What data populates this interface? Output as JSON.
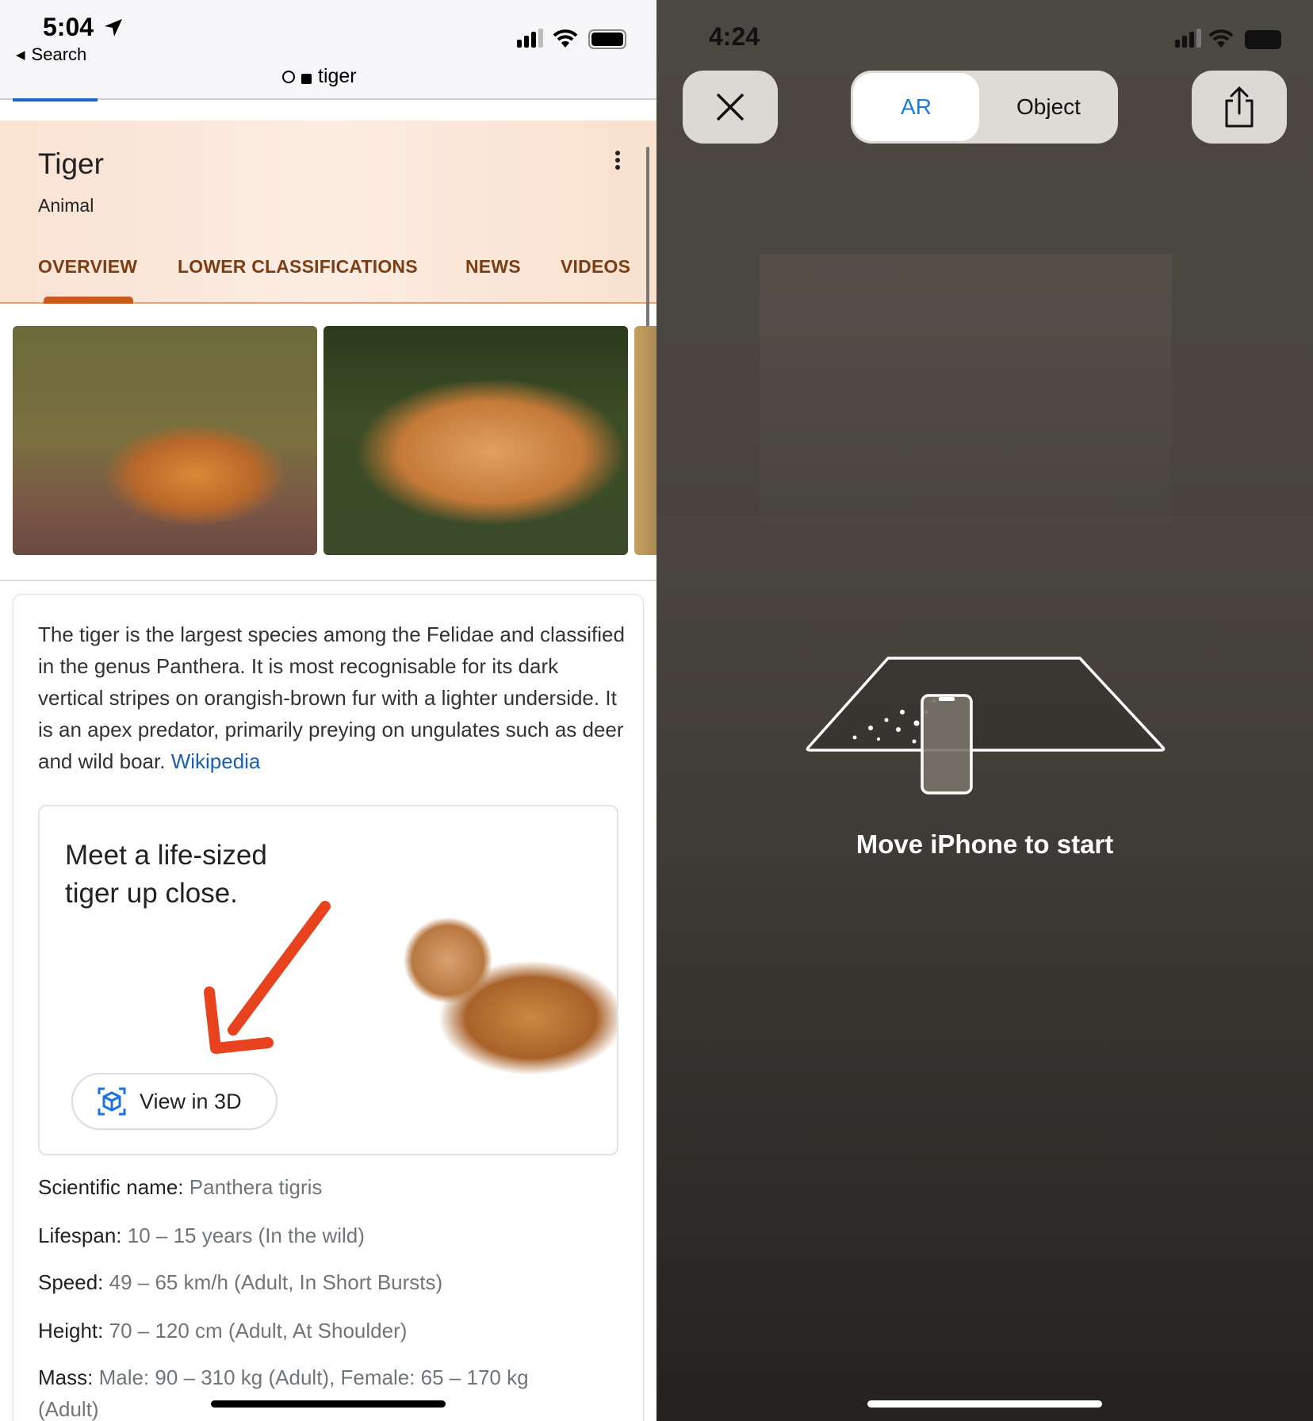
{
  "left": {
    "status": {
      "time": "5:04",
      "back_label": "Search"
    },
    "url_bar": {
      "text": "tiger"
    },
    "panel": {
      "title": "Tiger",
      "subtitle": "Animal",
      "tabs": [
        "OVERVIEW",
        "LOWER CLASSIFICATIONS",
        "NEWS",
        "VIDEOS"
      ],
      "active_tab": "OVERVIEW"
    },
    "description": {
      "text": "The tiger is the largest species among the Felidae and classified in the genus Panthera. It is most recognisable for its dark vertical stripes on orangish-brown fur with a lighter underside. It is an apex predator, primarily preying on ungulates such as deer and wild boar.",
      "source_link": "Wikipedia"
    },
    "promo": {
      "line1": "Meet a life-sized",
      "line2": "tiger up close.",
      "button": "View in 3D"
    },
    "facts": [
      {
        "label": "Scientific name:",
        "value": "Panthera tigris"
      },
      {
        "label": "Lifespan:",
        "value": "10 – 15 years (In the wild)"
      },
      {
        "label": "Speed:",
        "value": "49 – 65 km/h (Adult, In Short Bursts)"
      },
      {
        "label": "Height:",
        "value": "70 – 120 cm (Adult, At Shoulder)"
      },
      {
        "label": "Mass:",
        "value": "Male: 90 – 310 kg (Adult), Female: 65 – 170 kg"
      },
      {
        "label": "",
        "value": "(Adult)"
      }
    ]
  },
  "right": {
    "status": {
      "time": "4:24"
    },
    "segmented": {
      "options": [
        "AR",
        "Object"
      ],
      "selected": "AR"
    },
    "hint": "Move iPhone to start"
  },
  "colors": {
    "tab": "#7a3d14",
    "tab_indicator": "#c9581a",
    "link": "#1a5fb4",
    "ar_blue": "#1a7ae0",
    "panel_bg": "#fbe6d6"
  }
}
